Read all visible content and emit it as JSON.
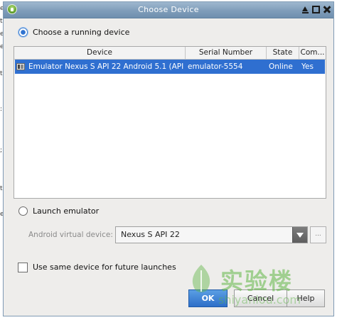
{
  "window": {
    "title": "Choose Device"
  },
  "running": {
    "label": "Choose a running device",
    "columns": [
      "Device",
      "Serial Number",
      "State",
      "Com..."
    ],
    "rows": [
      {
        "device": "Emulator Nexus S API 22 Android 5.1 (API",
        "serial": "emulator-5554",
        "state": "Online",
        "compatible": "Yes"
      }
    ]
  },
  "launch": {
    "label": "Launch emulator",
    "avd_label": "Android virtual device:",
    "avd_value": "Nexus S API 22",
    "browse_label": "..."
  },
  "reuse": {
    "label": "Use same device for future launches"
  },
  "buttons": {
    "ok": "OK",
    "cancel": "Cancel",
    "help": "Help"
  },
  "watermark": {
    "text": "实验楼",
    "sub": "shiyanlou.com"
  },
  "colors": {
    "selection": "#2f6fd0",
    "titlebar": "#7f9dba",
    "ok_button": "#2d6fc8",
    "watermark": "#60b646"
  },
  "icons": {
    "app": "android-studio-icon",
    "device": "emulator-device-icon"
  }
}
